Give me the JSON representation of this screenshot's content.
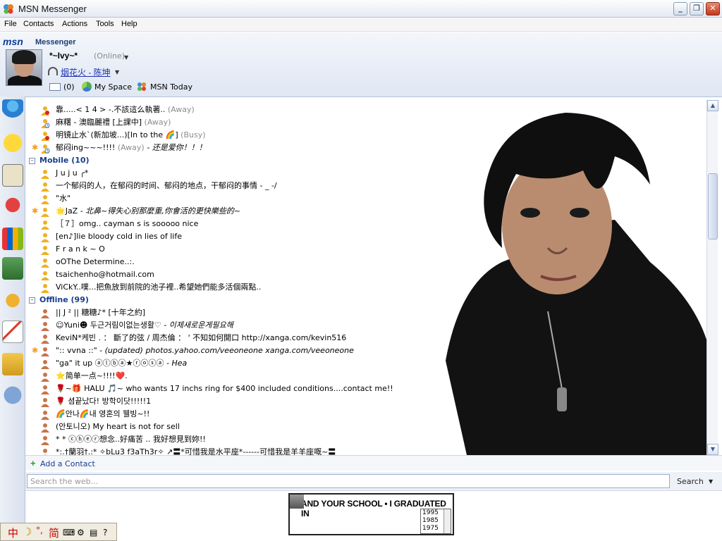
{
  "window": {
    "title": "MSN Messenger"
  },
  "menu": [
    "File",
    "Contacts",
    "Actions",
    "Tools",
    "Help"
  ],
  "header": {
    "logo": "msn",
    "product": "Messenger",
    "display_name": "*~Ivy~*",
    "status": "(Online)",
    "now_playing": "烟花火 - 陈坤",
    "mail_count": "(0)",
    "my_space": "My Space",
    "msn_today": "MSN Today"
  },
  "rows": [
    {
      "kind": "contact",
      "star": false,
      "text": "靠.....< 1 4 > -.不該這么執著..",
      "status": "(Away)",
      "icon": "busy"
    },
    {
      "kind": "contact",
      "star": false,
      "text": "麻糬  -  澳臨麗禮  [上課中]",
      "status": "(Away)",
      "icon": "away"
    },
    {
      "kind": "contact",
      "star": false,
      "text": "明镜止水`(新加坡...)[In to the 🌈]",
      "status": "(Busy)",
      "icon": "busy"
    },
    {
      "kind": "contact",
      "star": true,
      "text": "郁闷ing~~~!!!!",
      "status": "(Away)",
      "extra": " - 还是爱你！！！",
      "icon": "away"
    },
    {
      "kind": "group",
      "text": "Mobile (10)"
    },
    {
      "kind": "contact",
      "star": false,
      "text": "    J u j u  ╭*",
      "icon": "online"
    },
    {
      "kind": "contact",
      "star": false,
      "text": "    一个郁闷的人，在郁闷的时间、郁闷的地点，干郁闷的事情 - _ -/",
      "icon": "online"
    },
    {
      "kind": "contact",
      "star": false,
      "text": "\"水\"",
      "icon": "online"
    },
    {
      "kind": "contact",
      "star": true,
      "text": "🌟JaZ",
      "extra": " - 北鼻~得失心别那麼重,你會活的更快樂些的~",
      "icon": "online"
    },
    {
      "kind": "contact",
      "star": false,
      "text": "［７］omg.. cayman s is sooooo nice",
      "icon": "online"
    },
    {
      "kind": "contact",
      "star": false,
      "text": "[en♪]lie bloody cold in lies of life",
      "icon": "online"
    },
    {
      "kind": "contact",
      "star": false,
      "text": "F r a n k ~ O",
      "icon": "online"
    },
    {
      "kind": "contact",
      "star": false,
      "text": "oOThe Determine..:.",
      "icon": "online"
    },
    {
      "kind": "contact",
      "star": false,
      "text": "tsaichenho@hotmail.com",
      "icon": "online"
    },
    {
      "kind": "contact",
      "star": false,
      "text": "ViCkY..噗...把魚放到前院的池子裡..希望她們能多活個兩點..",
      "icon": "online"
    },
    {
      "kind": "group",
      "text": "Offline (99)"
    },
    {
      "kind": "contact",
      "star": false,
      "text": "                                  ||   J ²    ||   糖糖♪*                  [十年之約]",
      "icon": "offline"
    },
    {
      "kind": "contact",
      "star": false,
      "text": "    ☺Yuni☻    두근거림이없는생활♡",
      "extra": " - 이제새로운게필요해",
      "icon": "offline"
    },
    {
      "kind": "contact",
      "star": false,
      "text": "    KeviN*케빈 . ： 斷了的弦 / 周杰倫 ： ' 不知如何開口 http://xanga.com/kevin516",
      "icon": "offline"
    },
    {
      "kind": "contact",
      "star": true,
      "text": "\":: vvna ::\"",
      "extra": " - (updated) photos.yahoo.com/veeoneone     xanga.com/veeoneone",
      "icon": "offline"
    },
    {
      "kind": "contact",
      "star": false,
      "text": "\"ga\" it up ⓐⓛⓑⓐ★ⓡⓞⓢⓐ",
      "extra": " - Hea",
      "icon": "offline"
    },
    {
      "kind": "contact",
      "star": false,
      "text": "⭐简单一点~!!!!❤️.",
      "icon": "offline"
    },
    {
      "kind": "contact",
      "star": false,
      "text": "🌹~🎁 HALU 🎵~                                       who wants 17 inchs ring for  $400 included conditions....contact me!!",
      "icon": "offline"
    },
    {
      "kind": "contact",
      "star": false,
      "text": "🌹 셤끝났다! 방학이닷!!!!!1",
      "icon": "offline"
    },
    {
      "kind": "contact",
      "star": false,
      "text": "🌈안나🌈내 영혼의 웰빙~!!",
      "icon": "offline"
    },
    {
      "kind": "contact",
      "star": false,
      "text": "(안토니오) My heart is not for sell",
      "icon": "offline"
    },
    {
      "kind": "contact",
      "star": false,
      "text": "*  * ⓒⓗⓔⓡ想念..好痛苦 .. 我好想見到妳!!",
      "icon": "offline"
    },
    {
      "kind": "contact",
      "star": false,
      "text": "*:.†蘭羽†.:*  ✧bLu3 f3aTh3r✧    ↗〓*可惜我是水平座*------可惜我是羊羊座嘅~〓",
      "icon": "offline"
    }
  ],
  "add_contact": "Add a Contact",
  "search": {
    "placeholder": "Search the web...",
    "button": "Search"
  },
  "ad": {
    "text": "AND YOUR SCHOOL • I GRADUATED IN",
    "years": [
      "1995",
      "1985",
      "1975"
    ]
  },
  "ime": [
    "中",
    "简"
  ],
  "colors": {
    "group": "#173e8c",
    "status": "#8c8c8c",
    "link": "#1c2fb5"
  }
}
